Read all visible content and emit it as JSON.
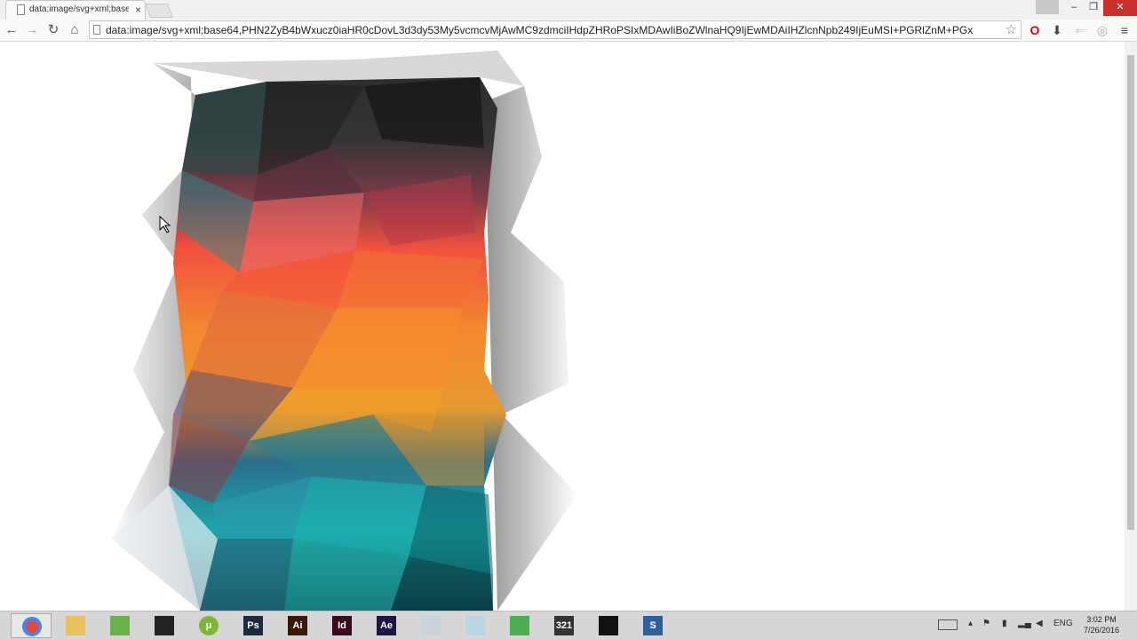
{
  "browser": {
    "tab": {
      "title": "data:image/svg+xml;base",
      "close": "×"
    },
    "window": {
      "minimize": "–",
      "restore": "❐",
      "close": "✕"
    },
    "nav": {
      "back": "←",
      "forward": "→",
      "reload": "↻",
      "home": "⌂"
    },
    "address": {
      "url": "data:image/svg+xml;base64,PHN2ZyB4bWxucz0iaHR0cDovL3d3dy53My5vcmcvMjAwMC9zdmciIHdpZHRoPSIxMDAwIiBoZWlnaHQ9IjEwMDAiIHZlcnNpb249IjEuMSI+PGRlZnM+PGx"
    },
    "toolbar_icons": {
      "opera": "O",
      "download": "⬇",
      "menu": "≡"
    }
  },
  "taskbar": {
    "apps": [
      {
        "name": "chrome",
        "glyph": "",
        "color": "#e04a3a"
      },
      {
        "name": "explorer",
        "glyph": "",
        "color": "#e8c25a"
      },
      {
        "name": "notepad",
        "glyph": "",
        "color": "#6ab04c"
      },
      {
        "name": "fan",
        "glyph": "",
        "color": "#222222"
      },
      {
        "name": "utorrent",
        "glyph": "μ",
        "color": "#78b832"
      },
      {
        "name": "photoshop",
        "glyph": "Ps",
        "color": "#1a2b3f"
      },
      {
        "name": "illustrator",
        "glyph": "Ai",
        "color": "#3a1a06"
      },
      {
        "name": "indesign",
        "glyph": "Id",
        "color": "#3b0a22"
      },
      {
        "name": "after-effects",
        "glyph": "Ae",
        "color": "#1c1542"
      },
      {
        "name": "calculator",
        "glyph": "",
        "color": "#c8d3dc"
      },
      {
        "name": "app-box",
        "glyph": "",
        "color": "#b9d7e3"
      },
      {
        "name": "app-green",
        "glyph": "",
        "color": "#4caf50"
      },
      {
        "name": "media-player",
        "glyph": "321",
        "color": "#333333"
      },
      {
        "name": "terminal",
        "glyph": "",
        "color": "#111111"
      },
      {
        "name": "app-s",
        "glyph": "S",
        "color": "#2f5f9a"
      }
    ],
    "tray": {
      "language": "ENG"
    },
    "clock": {
      "time": "3:02 PM",
      "date": "7/26/2016"
    }
  }
}
